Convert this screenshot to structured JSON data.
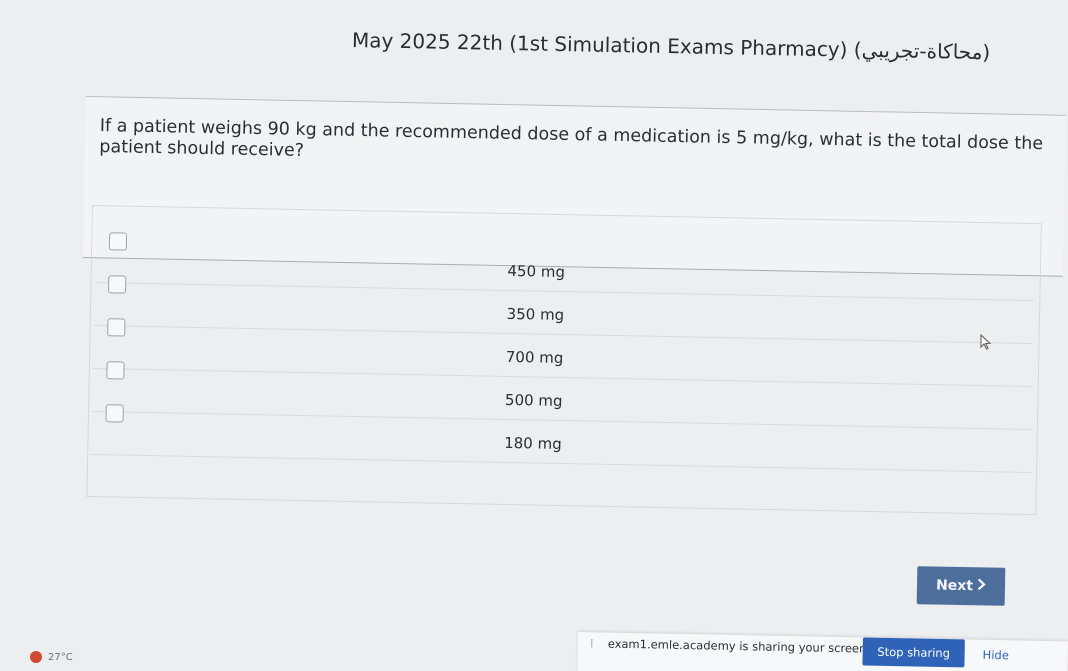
{
  "exam": {
    "title": "May 2025 22th (1st Simulation Exams Pharmacy) (محاكاة-تجريبي)"
  },
  "question": {
    "text": "If a patient weighs 90 kg and the recommended dose of a medication is 5 mg/kg, what is the total dose the patient should receive?"
  },
  "options": [
    {
      "label": "450 mg"
    },
    {
      "label": "350 mg"
    },
    {
      "label": "700 mg"
    },
    {
      "label": "500 mg"
    },
    {
      "label": "180 mg"
    }
  ],
  "navigation": {
    "next_label": "Next",
    "next_icon": "chevron-right-icon"
  },
  "share_bar": {
    "message": "exam1.emle.academy is sharing your screen.",
    "stop_label": "Stop sharing",
    "hide_label": "Hide"
  },
  "taskbar": {
    "temperature": "27°C"
  }
}
